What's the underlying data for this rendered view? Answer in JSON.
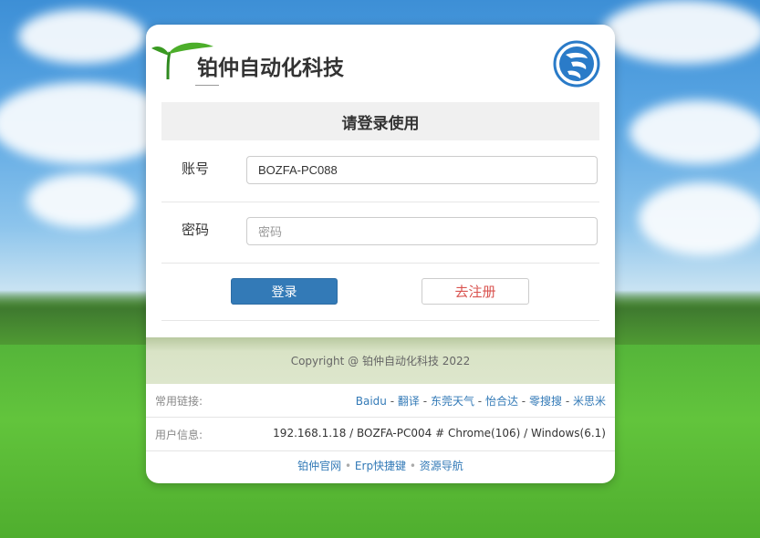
{
  "brand": {
    "name": "铂仲自动化科技"
  },
  "login": {
    "title": "请登录使用",
    "account_label": "账号",
    "account_value": "BOZFA-PC088",
    "password_label": "密码",
    "password_placeholder": "密码",
    "login_button": "登录",
    "register_button": "去注册"
  },
  "copyright": "Copyright @ 铂仲自动化科技 2022",
  "common_links": {
    "label": "常用链接:",
    "items": [
      "Baidu",
      "翻译",
      "东莞天气",
      "怡合达",
      "零搜搜",
      "米思米"
    ],
    "separator": "-"
  },
  "user_info": {
    "label": "用户信息:",
    "value": "192.168.1.18 / BOZFA-PC004 # Chrome(106) / Windows(6.1)"
  },
  "bottom_links": {
    "items": [
      "铂仲官网",
      "Erp快捷键",
      "资源导航"
    ],
    "separator": "•"
  },
  "colors": {
    "primary": "#337ab7",
    "danger": "#d9534f",
    "panel": "#f0f0f0"
  }
}
